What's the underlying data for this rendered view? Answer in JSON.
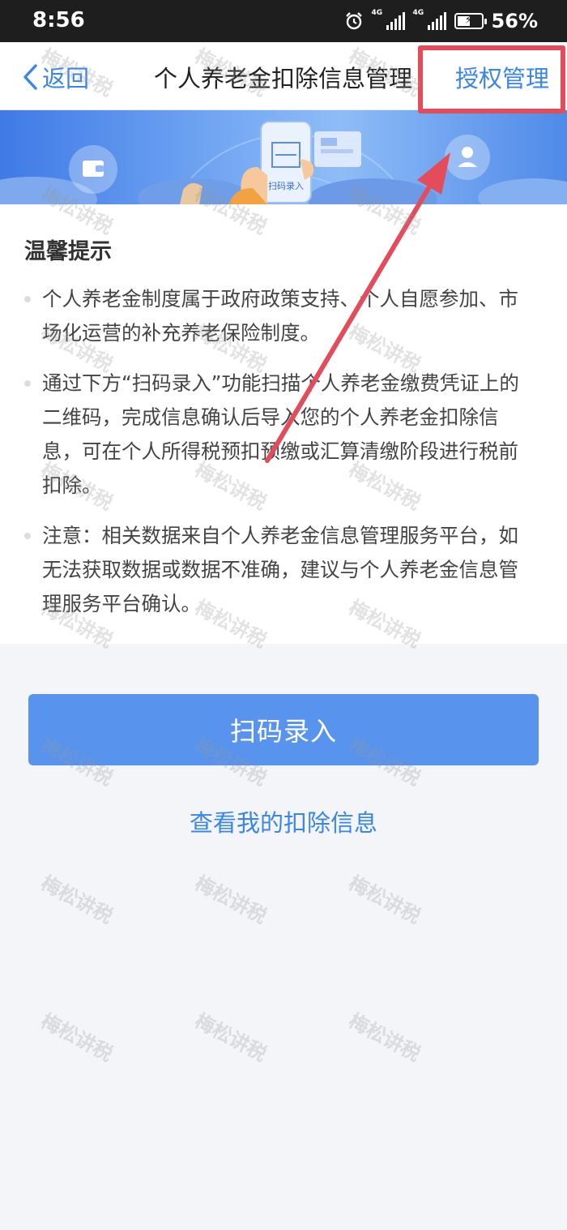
{
  "status_bar": {
    "time": "8:56",
    "network_1": "4G",
    "network_2": "4G",
    "battery": "56%",
    "battery_level": 0.56
  },
  "nav": {
    "back_label": "返回",
    "title": "个人养老金扣除信息管理",
    "action_label": "授权管理"
  },
  "banner": {
    "phone_label": "扫码录入"
  },
  "tips": {
    "title": "温馨提示",
    "items": [
      "个人养老金制度属于政府政策支持、个人自愿参加、市场化运营的补充养老保险制度。",
      "通过下方“扫码录入”功能扫描个人养老金缴费凭证上的二维码，完成信息确认后导入您的个人养老金扣除信息，可在个人所得税预扣预缴或汇算清缴阶段进行税前扣除。",
      "注意：相关数据来自个人养老金信息管理服务平台，如无法获取数据或数据不准确，建议与个人养老金信息管理服务平台确认。"
    ]
  },
  "actions": {
    "scan_button": "扫码录入",
    "view_link": "查看我的扣除信息"
  },
  "watermark": {
    "text": "梅松讲税"
  },
  "colors": {
    "accent": "#3a86e8",
    "button": "#5893ee",
    "annotation": "#e34d5b"
  }
}
